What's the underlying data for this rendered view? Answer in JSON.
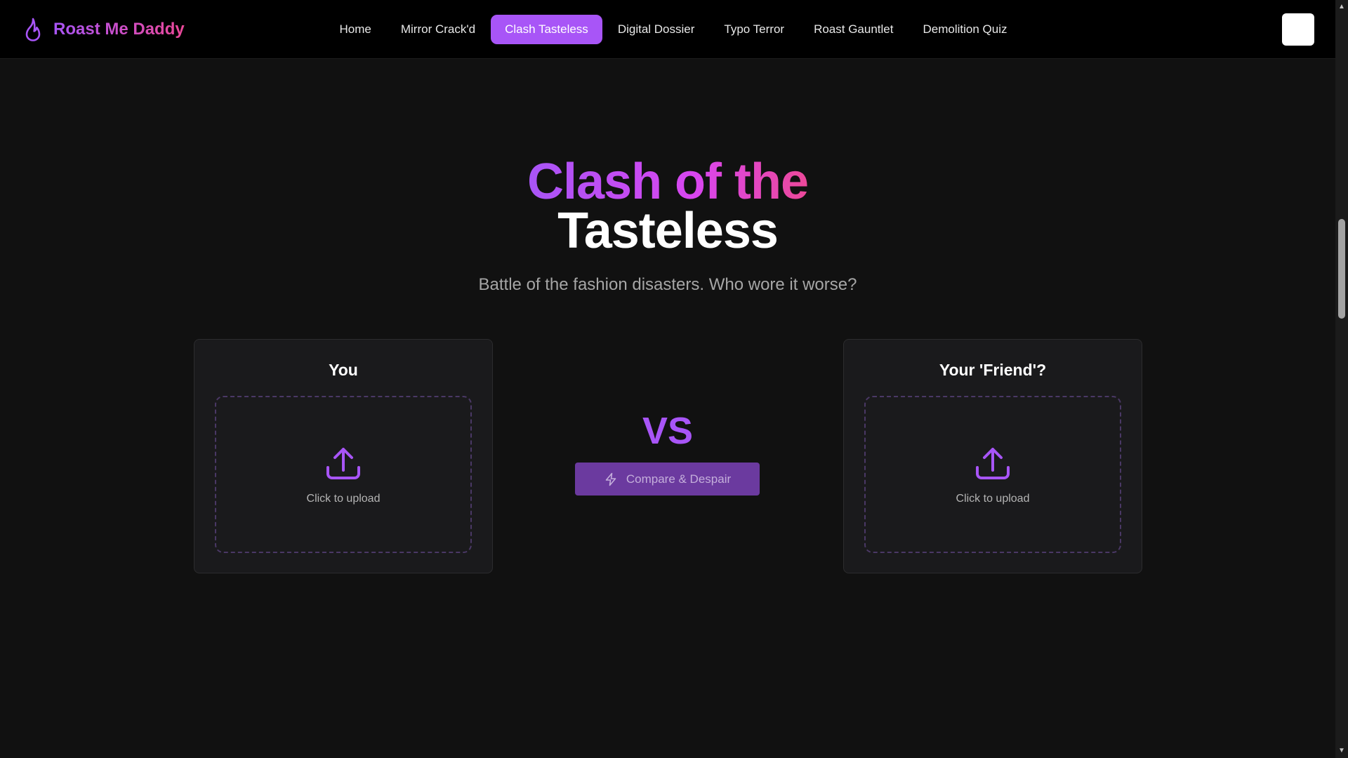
{
  "brand": {
    "name": "Roast Me Daddy",
    "icon": "flame-icon"
  },
  "nav": {
    "items": [
      {
        "label": "Home"
      },
      {
        "label": "Mirror Crack'd"
      },
      {
        "label": "Clash Tasteless",
        "active": true
      },
      {
        "label": "Digital Dossier"
      },
      {
        "label": "Typo Terror"
      },
      {
        "label": "Roast Gauntlet"
      },
      {
        "label": "Demolition Quiz"
      }
    ],
    "menu_button_icon": "menu-icon"
  },
  "hero": {
    "title_line1": "Clash of the",
    "title_line2": "Tasteless",
    "subtitle": "Battle of the fashion disasters. Who wore it worse?"
  },
  "contestants": {
    "left": {
      "title": "You",
      "upload_label": "Click to upload",
      "icon": "upload-icon"
    },
    "right": {
      "title": "Your 'Friend'?",
      "upload_label": "Click to upload",
      "icon": "upload-icon"
    }
  },
  "versus": {
    "label": "VS",
    "compare_button_label": "Compare & Despair",
    "compare_button_icon": "bolt-icon"
  },
  "colors": {
    "accent": "#a855f7",
    "accent_pink": "#ec4899",
    "background": "#111111",
    "navbar": "#000000",
    "card": "#1a1a1c",
    "button_disabled": "#6b3a9f"
  }
}
